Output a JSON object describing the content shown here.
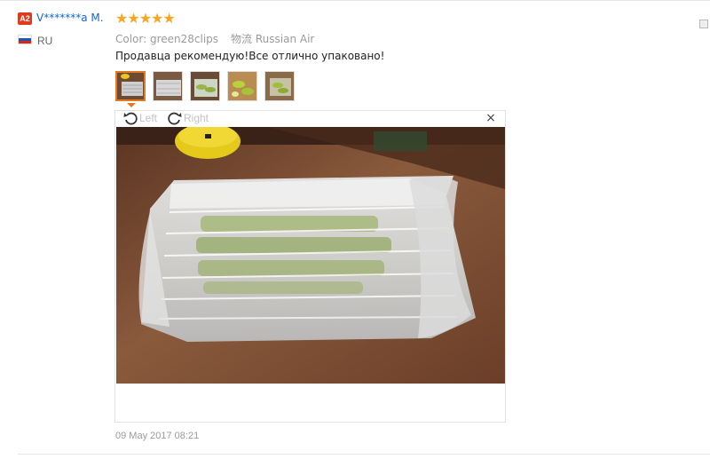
{
  "buyer": {
    "level_badge": "A2",
    "name": "V*******a M.",
    "country": "RU",
    "flag": [
      "#ffffff",
      "#1c57b8",
      "#d8261e"
    ]
  },
  "review": {
    "rating": 5,
    "stars": "★★★★★",
    "attr_color": "Color: green28clips",
    "attr_shipping": "物流 Russian Air",
    "text": "Продавца рекомендую!Все отлично упаковано!",
    "date": "09 May 2017 08:21"
  },
  "viewer": {
    "rotate_left_label": "Left",
    "rotate_right_label": "Right",
    "close_symbol": "×",
    "thumbnail_count": 5,
    "active_thumbnail": 1
  },
  "colors": {
    "accent": "#e07a25",
    "star": "#f5a623",
    "name_link": "#1d63c4",
    "badge": "#e03a1e"
  }
}
